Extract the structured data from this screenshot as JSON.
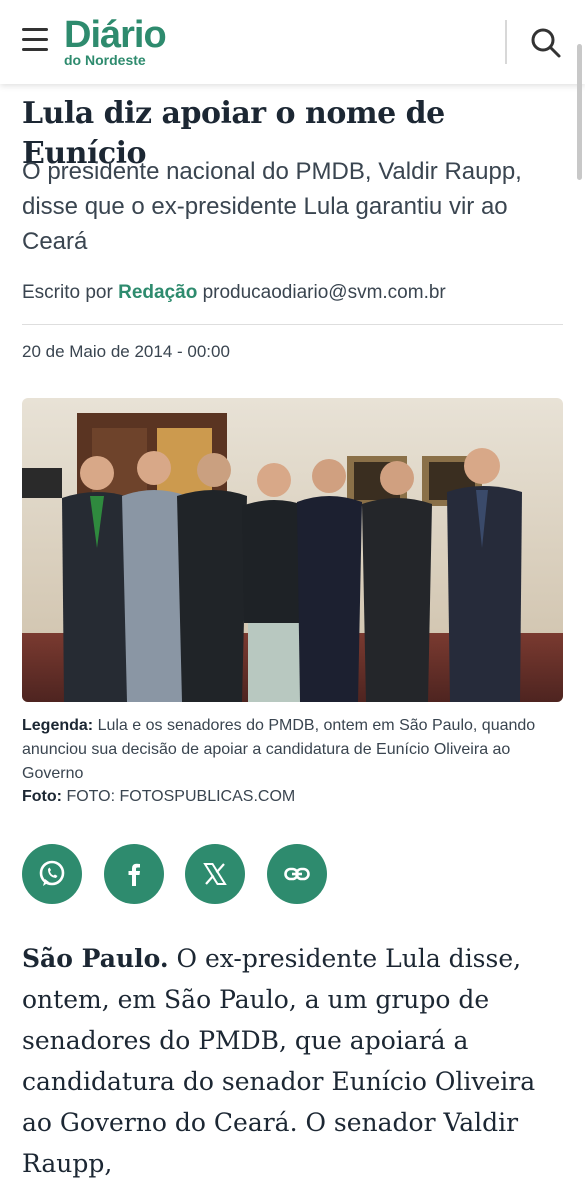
{
  "header": {
    "logo_main": "Diário",
    "logo_sub": "do Nordeste",
    "brand_color": "#2e8b6e"
  },
  "article": {
    "title": "Lula diz apoiar o nome de Eunício",
    "subtitle": "O presidente nacional do PMDB, Valdir Raupp, disse que o ex-presidente Lula garantiu vir ao Ceará",
    "byline_prefix": "Escrito por",
    "author": "Redação",
    "author_email": "producaodiario@svm.com.br",
    "date": "20 de Maio de 2014 - 00:00",
    "caption_label": "Legenda:",
    "caption_text": "Lula e os senadores do PMDB, ontem em São Paulo, quando anunciou sua decisão de apoiar a candidatura de Eunício Oliveira ao Governo",
    "credit_label": "Foto:",
    "credit_text": "FOTO: FOTOSPUBLICAS.COM",
    "lead_place": "São Paulo.",
    "lead_text": "O ex-presidente Lula disse, ontem, em São Paulo, a um grupo de senadores do PMDB, que apoiará a candidatura do senador Eunício Oliveira ao Governo do Ceará. O senador Valdir Raupp,"
  },
  "share_buttons": [
    {
      "icon": "whatsapp-icon"
    },
    {
      "icon": "facebook-icon"
    },
    {
      "icon": "x-icon"
    },
    {
      "icon": "link-icon"
    }
  ]
}
